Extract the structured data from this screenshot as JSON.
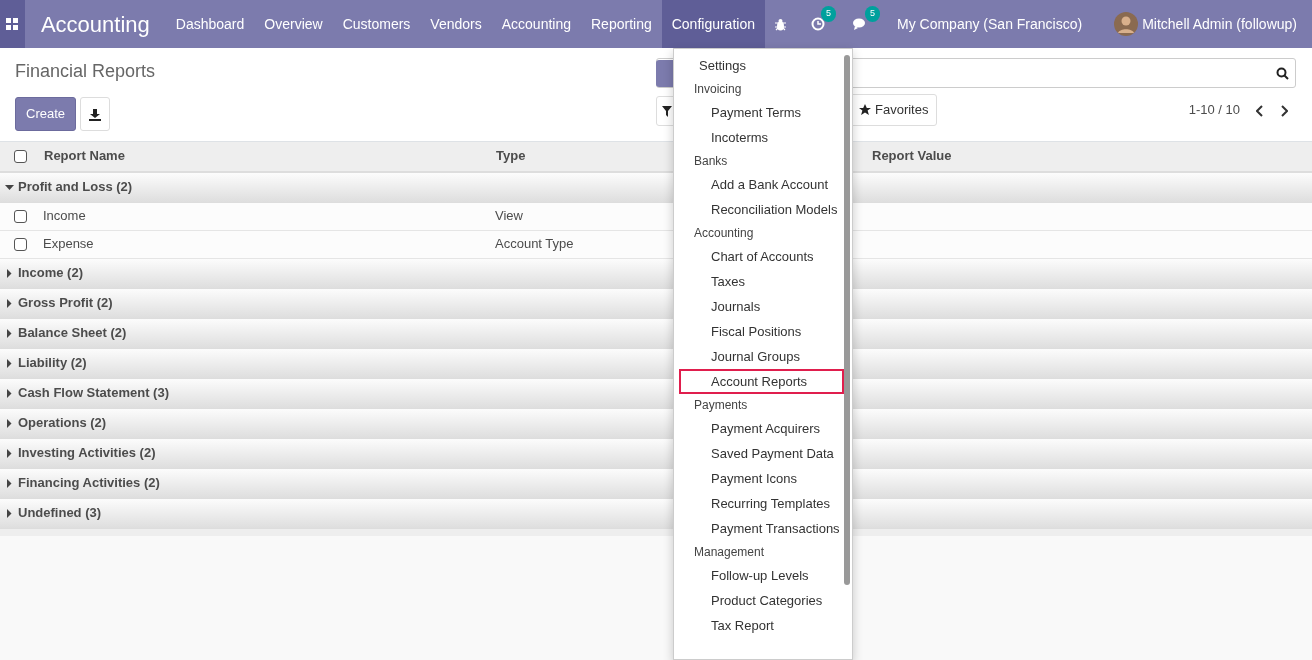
{
  "navbar": {
    "app_title": "Accounting",
    "menus": [
      {
        "label": "Dashboard",
        "selected": false
      },
      {
        "label": "Overview",
        "selected": false
      },
      {
        "label": "Customers",
        "selected": false
      },
      {
        "label": "Vendors",
        "selected": false
      },
      {
        "label": "Accounting",
        "selected": false
      },
      {
        "label": "Reporting",
        "selected": false
      },
      {
        "label": "Configuration",
        "selected": true
      }
    ],
    "activity_count": "5",
    "message_count": "5",
    "company": "My Company (San Francisco)",
    "user": "Mitchell Admin (followup)"
  },
  "control_panel": {
    "breadcrumb": "Financial Reports",
    "create_button": "Create",
    "favorites_button": "Favorites",
    "pager": "1-10 / 10"
  },
  "table": {
    "select_all_checked": false,
    "columns": [
      "Report Name",
      "Type",
      "",
      "Report Value"
    ],
    "groups": [
      {
        "label": "Profit and Loss (2)",
        "expanded": true,
        "rows": [
          {
            "name": "Income",
            "type": "View",
            "checked": false
          },
          {
            "name": "Expense",
            "type": "Account Type",
            "checked": false
          }
        ]
      },
      {
        "label": "Income (2)",
        "expanded": false
      },
      {
        "label": "Gross Profit (2)",
        "expanded": false
      },
      {
        "label": "Balance Sheet (2)",
        "expanded": false
      },
      {
        "label": "Liability (2)",
        "expanded": false
      },
      {
        "label": "Cash Flow Statement (3)",
        "expanded": false
      },
      {
        "label": "Operations (2)",
        "expanded": false
      },
      {
        "label": "Investing Activities (2)",
        "expanded": false
      },
      {
        "label": "Financing Activities (2)",
        "expanded": false
      },
      {
        "label": "Undefined (3)",
        "expanded": false
      }
    ]
  },
  "dropdown": {
    "items": [
      {
        "kind": "item",
        "label": "Settings",
        "highlighted": false
      },
      {
        "kind": "header",
        "label": "Invoicing"
      },
      {
        "kind": "subitem",
        "label": "Payment Terms",
        "highlighted": false
      },
      {
        "kind": "subitem",
        "label": "Incoterms",
        "highlighted": false
      },
      {
        "kind": "header",
        "label": "Banks"
      },
      {
        "kind": "subitem",
        "label": "Add a Bank Account",
        "highlighted": false
      },
      {
        "kind": "subitem",
        "label": "Reconciliation Models",
        "highlighted": false
      },
      {
        "kind": "header",
        "label": "Accounting"
      },
      {
        "kind": "subitem",
        "label": "Chart of Accounts",
        "highlighted": false
      },
      {
        "kind": "subitem",
        "label": "Taxes",
        "highlighted": false
      },
      {
        "kind": "subitem",
        "label": "Journals",
        "highlighted": false
      },
      {
        "kind": "subitem",
        "label": "Fiscal Positions",
        "highlighted": false
      },
      {
        "kind": "subitem",
        "label": "Journal Groups",
        "highlighted": false
      },
      {
        "kind": "subitem",
        "label": "Account Reports",
        "highlighted": true
      },
      {
        "kind": "header",
        "label": "Payments"
      },
      {
        "kind": "subitem",
        "label": "Payment Acquirers",
        "highlighted": false
      },
      {
        "kind": "subitem",
        "label": "Saved Payment Data",
        "highlighted": false
      },
      {
        "kind": "subitem",
        "label": "Payment Icons",
        "highlighted": false
      },
      {
        "kind": "subitem",
        "label": "Recurring Templates",
        "highlighted": false
      },
      {
        "kind": "subitem",
        "label": "Payment Transactions",
        "highlighted": false
      },
      {
        "kind": "header",
        "label": "Management"
      },
      {
        "kind": "subitem",
        "label": "Follow-up Levels",
        "highlighted": false
      },
      {
        "kind": "subitem",
        "label": "Product Categories",
        "highlighted": false
      },
      {
        "kind": "subitem",
        "label": "Tax Report",
        "highlighted": false
      }
    ]
  }
}
